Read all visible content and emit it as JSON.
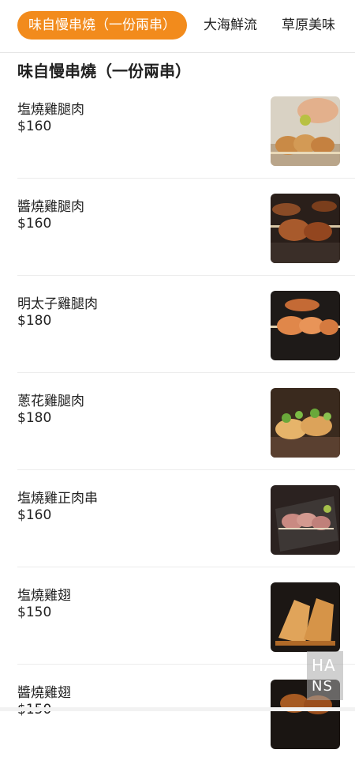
{
  "nav": {
    "tabs": [
      {
        "label": "味自慢串燒（一份兩串）",
        "active": true
      },
      {
        "label": "大海鮮流",
        "active": false
      },
      {
        "label": "草原美味",
        "active": false
      }
    ],
    "accent_color": "#f28b1c"
  },
  "section": {
    "title": "味自慢串燒（一份兩串）"
  },
  "items": [
    {
      "name": "塩燒雞腿肉",
      "price": "$160"
    },
    {
      "name": "醬燒雞腿肉",
      "price": "$160"
    },
    {
      "name": "明太子雞腿肉",
      "price": "$180"
    },
    {
      "name": "蔥花雞腿肉",
      "price": "$180"
    },
    {
      "name": "塩燒雞正肉串",
      "price": "$160"
    },
    {
      "name": "塩燒雞翅",
      "price": "$150"
    },
    {
      "name": "醬燒雞翅",
      "price": "$150"
    }
  ],
  "watermark": {
    "line1": "HA",
    "line2": "NS"
  }
}
